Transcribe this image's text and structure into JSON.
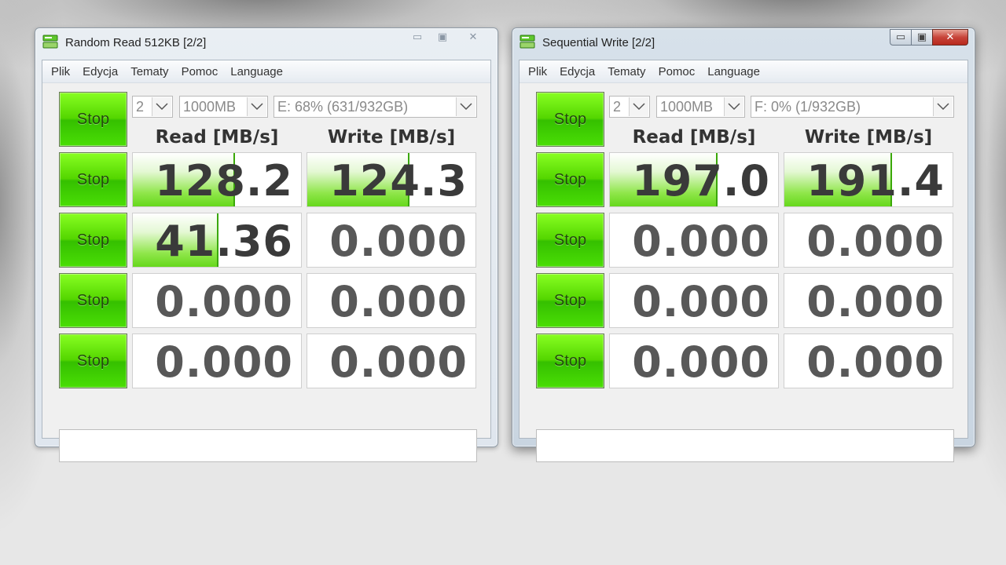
{
  "windows": [
    {
      "title": "Random Read 512KB [2/2]",
      "state": "inactive",
      "caption": {
        "minimize": "▭",
        "maximize": "▣",
        "close": "✕"
      },
      "menu": [
        "Plik",
        "Edycja",
        "Tematy",
        "Pomoc",
        "Language"
      ],
      "all_button": "Stop",
      "count": "2",
      "size": "1000MB",
      "drive": "E: 68% (631/932GB)",
      "headers": {
        "read": "Read [MB/s]",
        "write": "Write [MB/s]"
      },
      "rows": [
        {
          "button": "Stop",
          "read": "128.2",
          "read_fill": 0.6,
          "write": "124.3",
          "write_fill": 0.6
        },
        {
          "button": "Stop",
          "read": "41.36",
          "read_fill": 0.5,
          "write": "0.000",
          "write_fill": 0
        },
        {
          "button": "Stop",
          "read": "0.000",
          "read_fill": 0,
          "write": "0.000",
          "write_fill": 0
        },
        {
          "button": "Stop",
          "read": "0.000",
          "read_fill": 0,
          "write": "0.000",
          "write_fill": 0
        }
      ],
      "comment": ""
    },
    {
      "title": "Sequential Write [2/2]",
      "state": "active",
      "caption": {
        "minimize": "▭",
        "maximize": "▣",
        "close": "✕"
      },
      "menu": [
        "Plik",
        "Edycja",
        "Tematy",
        "Pomoc",
        "Language"
      ],
      "all_button": "Stop",
      "count": "2",
      "size": "1000MB",
      "drive": "F: 0% (1/932GB)",
      "headers": {
        "read": "Read [MB/s]",
        "write": "Write [MB/s]"
      },
      "rows": [
        {
          "button": "Stop",
          "read": "197.0",
          "read_fill": 0.63,
          "write": "191.4",
          "write_fill": 0.63
        },
        {
          "button": "Stop",
          "read": "0.000",
          "read_fill": 0,
          "write": "0.000",
          "write_fill": 0
        },
        {
          "button": "Stop",
          "read": "0.000",
          "read_fill": 0,
          "write": "0.000",
          "write_fill": 0
        },
        {
          "button": "Stop",
          "read": "0.000",
          "read_fill": 0,
          "write": "0.000",
          "write_fill": 0
        }
      ],
      "comment": ""
    }
  ],
  "colors": {
    "accent_green": "#54d600",
    "bar_green": "#66d81c",
    "close_red": "#c7443a"
  }
}
